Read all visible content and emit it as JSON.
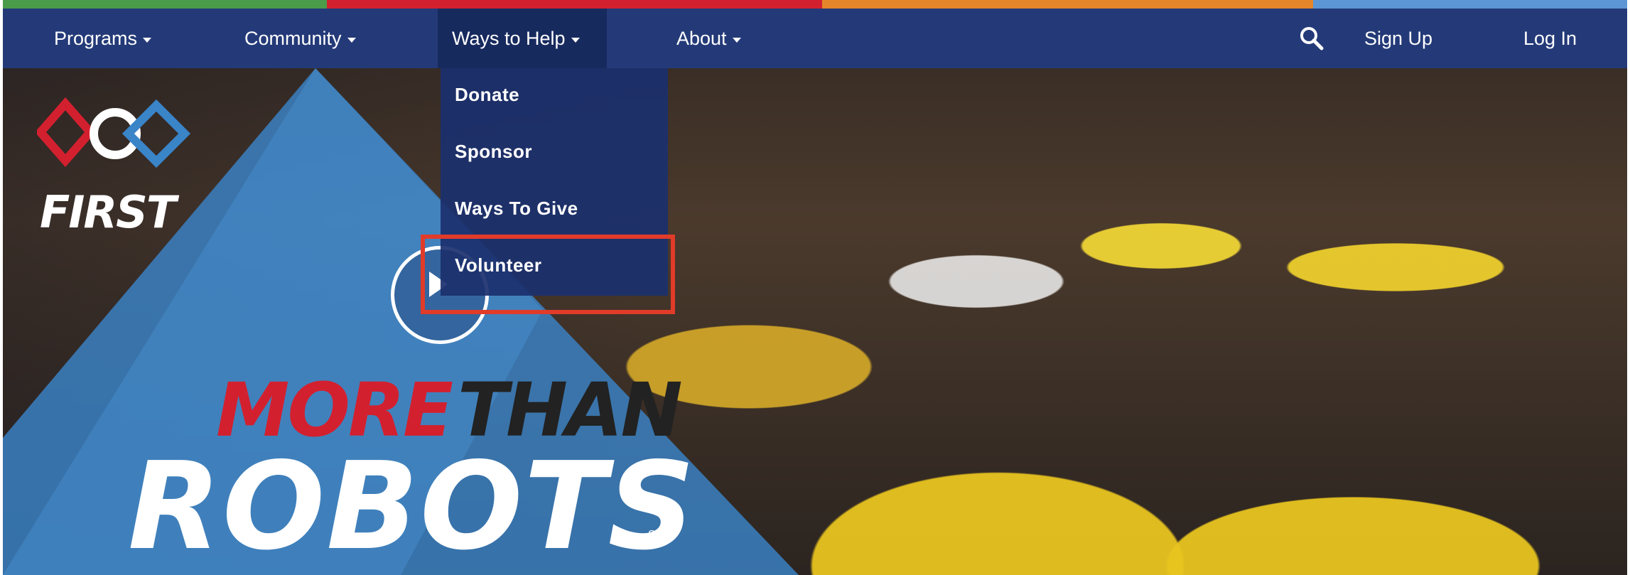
{
  "nav": {
    "items": [
      {
        "label": "Programs",
        "has_dropdown": true
      },
      {
        "label": "Community",
        "has_dropdown": true
      },
      {
        "label": "Ways to Help",
        "has_dropdown": true,
        "active": true
      },
      {
        "label": "About",
        "has_dropdown": true
      }
    ],
    "search_icon": "search-icon",
    "sign_up": "Sign Up",
    "log_in": "Log In"
  },
  "dropdown": {
    "items": [
      "Donate",
      "Sponsor",
      "Ways To Give",
      "Volunteer"
    ],
    "highlighted": "Volunteer"
  },
  "hero": {
    "logo_text": "FIRST",
    "tagline_more": "MORE",
    "tagline_than": "THAN",
    "tagline_robots": "ROBOTS",
    "service_mark": "SM",
    "play_icon": "play-icon"
  },
  "colors": {
    "stripe": [
      "#4a9c4a",
      "#d3202f",
      "#e5862b",
      "#5c96d5"
    ],
    "nav_bg": "#243a78",
    "highlight": "#e13b2a"
  }
}
